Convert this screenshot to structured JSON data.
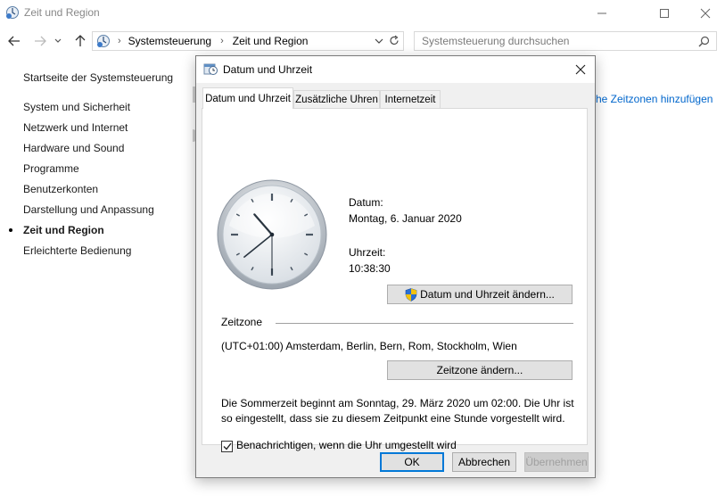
{
  "window": {
    "title": "Zeit und Region",
    "icon": "control-panel-icon"
  },
  "address": {
    "segments": [
      "Systemsteuerung",
      "Zeit und Region"
    ]
  },
  "search": {
    "placeholder": "Systemsteuerung durchsuchen"
  },
  "sidebar": {
    "home": "Startseite der Systemsteuerung",
    "items": [
      {
        "label": "System und Sicherheit"
      },
      {
        "label": "Netzwerk und Internet"
      },
      {
        "label": "Hardware und Sound"
      },
      {
        "label": "Programme"
      },
      {
        "label": "Benutzerkonten"
      },
      {
        "label": "Darstellung und Anpassung"
      },
      {
        "label": "Zeit und Region",
        "current": true
      },
      {
        "label": "Erleichterte Bedienung"
      }
    ]
  },
  "background": {
    "link_fragment": "he Zeitzonen hinzufügen"
  },
  "dialog": {
    "title": "Datum und Uhrzeit",
    "tabs": [
      {
        "label": "Datum und Uhrzeit",
        "active": true
      },
      {
        "label": "Zusätzliche Uhren"
      },
      {
        "label": "Internetzeit"
      }
    ],
    "clock": {
      "hour": 10,
      "minute": 38,
      "second": 30
    },
    "date_label": "Datum:",
    "date_value": "Montag, 6. Januar 2020",
    "time_label": "Uhrzeit:",
    "time_value": "10:38:30",
    "change_datetime_button": "Datum und Uhrzeit ändern...",
    "timezone_heading": "Zeitzone",
    "timezone_value": "(UTC+01:00) Amsterdam, Berlin, Bern, Rom, Stockholm, Wien",
    "change_timezone_button": "Zeitzone ändern...",
    "dst_line1": "Die Sommerzeit beginnt am Sonntag, 29. März 2020 um 02:00. Die Uhr ist",
    "dst_line2": "so eingestellt, dass sie zu diesem Zeitpunkt eine Stunde vorgestellt wird.",
    "notify_checkbox": {
      "label": "Benachrichtigen, wenn die Uhr umgestellt wird",
      "checked": true
    },
    "buttons": {
      "ok": "OK",
      "cancel": "Abbrechen",
      "apply": "Übernehmen"
    }
  },
  "colors": {
    "accent": "#0078d7",
    "link": "#0066cc",
    "shield_blue": "#2a6fd6",
    "shield_yellow": "#f4c20d"
  }
}
